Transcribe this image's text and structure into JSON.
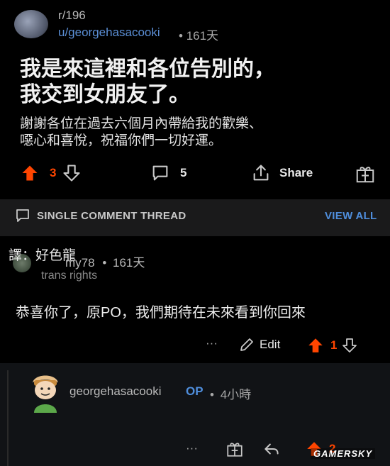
{
  "post": {
    "subreddit": "r/196",
    "author": "u/georgehasacooki",
    "age_sep": "•",
    "age": "161天",
    "title_line1": "我是來這裡和各位告別的，",
    "title_line2": "我交到女朋友了。",
    "body_line1": "謝謝各位在過去六個月內帶給我的歡樂、",
    "body_line2": "噁心和喜悅，祝福你們一切好運。",
    "score": "3",
    "comments": "5",
    "share_label": "Share"
  },
  "thread": {
    "label": "SINGLE COMMENT THREAD",
    "view_all": "VIEW ALL"
  },
  "comment1": {
    "translation_label": "譯：好色龍",
    "author": "my78",
    "age_sep": "•",
    "age": "161天",
    "flair": "trans rights",
    "text": "恭喜你了，原PO，我們期待在未來看到你回來",
    "more": "···",
    "edit": "Edit",
    "score": "1"
  },
  "reply": {
    "author": "georgehasacooki",
    "op_badge": "OP",
    "age_sep": "•",
    "age": "4小時",
    "more": "···",
    "score": "2"
  },
  "watermark": "GAMERSKY",
  "colors": {
    "upvote": "#ff4500",
    "link": "#4f8edc",
    "bg": "#000000"
  }
}
